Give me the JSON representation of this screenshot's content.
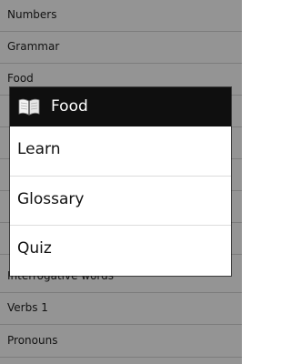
{
  "background_list": {
    "items": [
      "Numbers",
      "Grammar",
      "Food",
      "",
      "",
      "",
      "",
      "",
      "Interrogative words",
      "Verbs 1",
      "Pronouns"
    ]
  },
  "dialog": {
    "title": "Food",
    "icon": "book-icon",
    "options": [
      "Learn",
      "Glossary",
      "Quiz"
    ]
  }
}
